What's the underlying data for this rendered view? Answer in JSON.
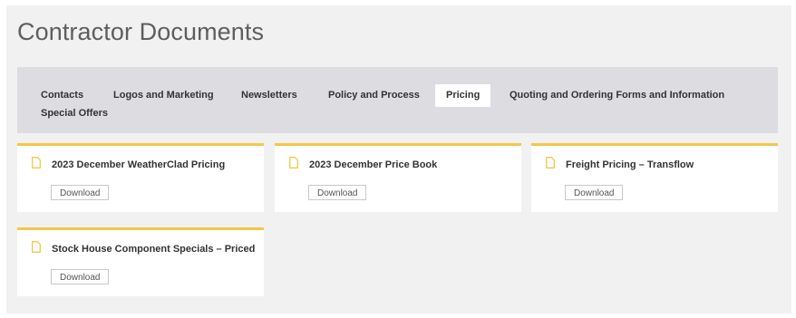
{
  "page": {
    "title": "Contractor Documents"
  },
  "tabs": [
    {
      "label": "Contacts",
      "active": false
    },
    {
      "label": "Logos and Marketing",
      "active": false
    },
    {
      "label": "Newsletters",
      "active": false
    },
    {
      "label": "Policy and Process",
      "active": false
    },
    {
      "label": "Pricing",
      "active": true
    },
    {
      "label": "Quoting and Ordering Forms and Information",
      "active": false
    },
    {
      "label": "Special Offers",
      "active": false
    }
  ],
  "documents": [
    {
      "title": "2023 December WeatherClad Pricing",
      "button_label": "Download"
    },
    {
      "title": "2023 December Price Book",
      "button_label": "Download"
    },
    {
      "title": "Freight Pricing – Transflow",
      "button_label": "Download"
    },
    {
      "title": "Stock House Component Specials – Priced",
      "button_label": "Download"
    }
  ],
  "colors": {
    "accent": "#f2c84b",
    "tab_bar": "#dcdce1",
    "panel": "#f1f1f1",
    "title": "#5e5e5e"
  },
  "icons": {
    "document": "document-icon"
  }
}
